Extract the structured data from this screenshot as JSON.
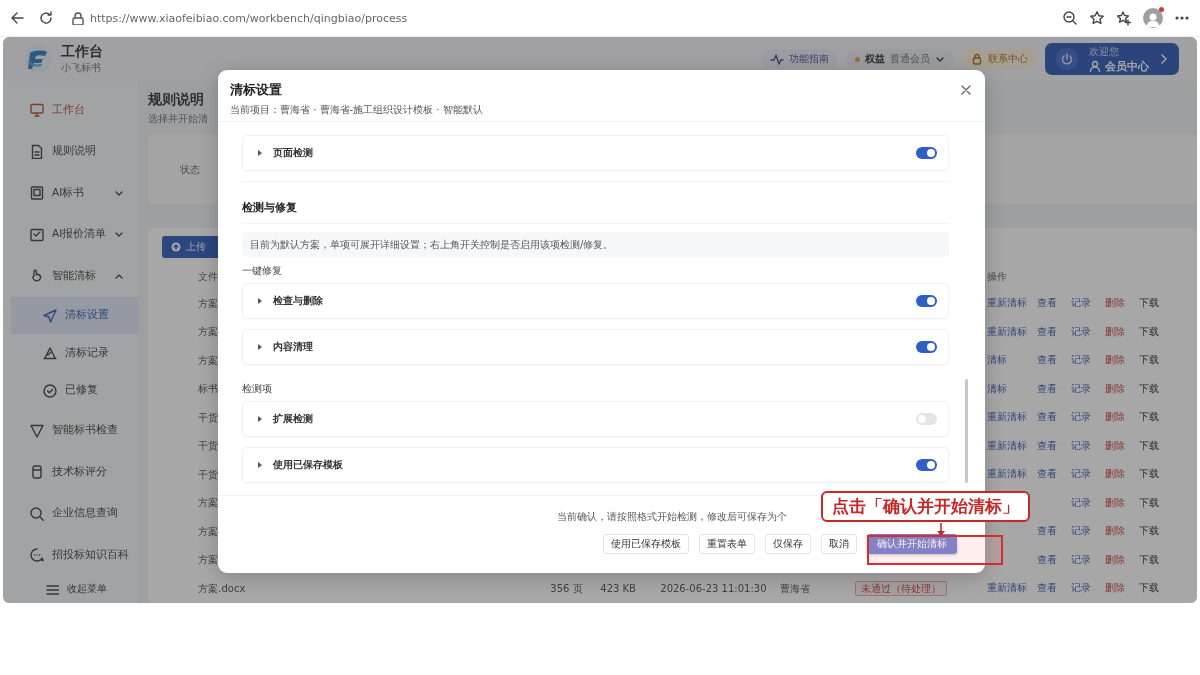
{
  "browser": {
    "url": "https://www.xiaofeibiao.com/workbench/qingbiao/process"
  },
  "app": {
    "title": "工作台",
    "subtitle": "小飞标书"
  },
  "header": {
    "guide": "功能指南",
    "plan_label": "权益",
    "plan_value": "普通会员",
    "contact": "联系中心",
    "member_greeting": "欢迎您",
    "member_label": "会员中心"
  },
  "sidebar": {
    "items": [
      {
        "label": "工作台",
        "kind": "home",
        "selected": false
      },
      {
        "label": "规则说明",
        "kind": "link",
        "selected": false
      },
      {
        "label": "AI标书",
        "kind": "link",
        "selected": false,
        "expanded": false
      },
      {
        "label": "AI报价清单",
        "kind": "link",
        "selected": false,
        "expanded": false
      },
      {
        "label": "智能清标",
        "kind": "link",
        "selected": false,
        "expanded": true,
        "children": [
          {
            "label": "清标设置",
            "selected": true
          },
          {
            "label": "清标记录",
            "selected": false
          },
          {
            "label": "已修复",
            "selected": false
          }
        ]
      },
      {
        "label": "智能标书检查",
        "kind": "link",
        "selected": false
      },
      {
        "label": "技术标评分",
        "kind": "link",
        "selected": false
      },
      {
        "label": "企业信息查询",
        "kind": "link",
        "selected": false
      },
      {
        "label": "招投标知识百科",
        "kind": "link",
        "selected": false
      }
    ],
    "collapse": "收起菜单"
  },
  "main": {
    "title": "规则说明",
    "subtitle": "选择并开始清",
    "filter_label": "状态",
    "upload": "上传",
    "table": {
      "columns": {
        "name": "文件",
        "actions": "操作"
      },
      "rows": [
        {
          "name": "方案",
          "actions": [
            {
              "kind": "retry",
              "label": "重新清标"
            },
            {
              "kind": "view",
              "label": "查看"
            },
            {
              "kind": "log",
              "label": "记录"
            },
            {
              "kind": "delete",
              "label": "删除"
            },
            {
              "kind": "download",
              "label": "下载"
            }
          ]
        },
        {
          "name": "方案",
          "actions": [
            {
              "kind": "retry",
              "label": "重新清标"
            },
            {
              "kind": "view",
              "label": "查看"
            },
            {
              "kind": "log",
              "label": "记录"
            },
            {
              "kind": "delete",
              "label": "删除"
            },
            {
              "kind": "download",
              "label": "下载"
            }
          ]
        },
        {
          "name": "方案",
          "actions": [
            {
              "kind": "retry",
              "label": "清标"
            },
            {
              "kind": "view",
              "label": "查看"
            },
            {
              "kind": "log",
              "label": "记录"
            },
            {
              "kind": "delete",
              "label": "删除"
            },
            {
              "kind": "download",
              "label": "下载"
            }
          ]
        },
        {
          "name": "标书",
          "actions": [
            {
              "kind": "retry",
              "label": "清标"
            },
            {
              "kind": "view",
              "label": "查看"
            },
            {
              "kind": "log",
              "label": "记录"
            },
            {
              "kind": "delete",
              "label": "删除"
            },
            {
              "kind": "download",
              "label": "下载"
            }
          ]
        },
        {
          "name": "干货",
          "actions": [
            {
              "kind": "retry",
              "label": "重新清标"
            },
            {
              "kind": "view",
              "label": "查看"
            },
            {
              "kind": "log",
              "label": "记录"
            },
            {
              "kind": "delete",
              "label": "删除"
            },
            {
              "kind": "download",
              "label": "下载"
            }
          ]
        },
        {
          "name": "干货",
          "actions": [
            {
              "kind": "retry",
              "label": "重新清标"
            },
            {
              "kind": "view",
              "label": "查看"
            },
            {
              "kind": "log",
              "label": "记录"
            },
            {
              "kind": "delete",
              "label": "删除"
            },
            {
              "kind": "download",
              "label": "下载"
            }
          ]
        },
        {
          "name": "干货",
          "actions": [
            {
              "kind": "retry",
              "label": "重新清标"
            },
            {
              "kind": "view",
              "label": "查看"
            },
            {
              "kind": "log",
              "label": "记录"
            },
            {
              "kind": "delete",
              "label": "删除"
            },
            {
              "kind": "download",
              "label": "下载"
            }
          ]
        },
        {
          "name": "方案",
          "actions": [
            {
              "kind": "log",
              "label": "记录"
            },
            {
              "kind": "delete",
              "label": "删除"
            },
            {
              "kind": "download",
              "label": "下载"
            }
          ]
        },
        {
          "name": "方案",
          "actions": [
            {
              "kind": "view",
              "label": "查看"
            },
            {
              "kind": "log",
              "label": "记录"
            },
            {
              "kind": "delete",
              "label": "删除"
            },
            {
              "kind": "download",
              "label": "下载"
            }
          ]
        },
        {
          "name": "方案",
          "actions": [
            {
              "kind": "view",
              "label": "查看"
            },
            {
              "kind": "log",
              "label": "记录"
            },
            {
              "kind": "delete",
              "label": "删除"
            },
            {
              "kind": "download",
              "label": "下载"
            }
          ]
        },
        {
          "name": "方案.docx",
          "pages": "356 页",
          "size": "423 KB",
          "time": "2026-06-23 11:01:30",
          "user": "曹海省",
          "status": "未通过（待处理）",
          "actions": [
            {
              "kind": "retry",
              "label": "重新清标"
            },
            {
              "kind": "view",
              "label": "查看"
            },
            {
              "kind": "log",
              "label": "记录"
            },
            {
              "kind": "delete",
              "label": "删除"
            },
            {
              "kind": "download",
              "label": "下载"
            }
          ]
        }
      ]
    }
  },
  "modal": {
    "title": "清标设置",
    "subtitle": "当前项目：曹海省 · 曹海省-施工组织设计模板 · 智能默认",
    "sections": [
      {
        "kind": "item",
        "label": "页面检测",
        "on": true
      },
      {
        "kind": "heading",
        "label": "检测与修复"
      },
      {
        "kind": "note",
        "label": "目前为默认方案，单项可展开详细设置；右上角开关控制是否启用该项检测/修复。"
      },
      {
        "kind": "group",
        "label": "一键修复"
      },
      {
        "kind": "item",
        "label": "检查与删除",
        "on": true
      },
      {
        "kind": "item",
        "label": "内容清理",
        "on": true
      },
      {
        "kind": "group",
        "label": "检测项"
      },
      {
        "kind": "item",
        "label": "扩展检测",
        "on": false
      },
      {
        "kind": "item",
        "label": "使用已保存模板",
        "on": true
      }
    ],
    "footer_note": "当前确认，请按照格式开始检测，修改后可保存为个",
    "buttons": [
      {
        "label": "使用已保存模板",
        "kind": "default"
      },
      {
        "label": "重置表单",
        "kind": "default"
      },
      {
        "label": "仅保存",
        "kind": "default"
      },
      {
        "label": "取消",
        "kind": "default"
      },
      {
        "label": "确认并开始清标",
        "kind": "primary"
      }
    ]
  },
  "annotation": {
    "text": "点击「确认并开始清标」"
  }
}
